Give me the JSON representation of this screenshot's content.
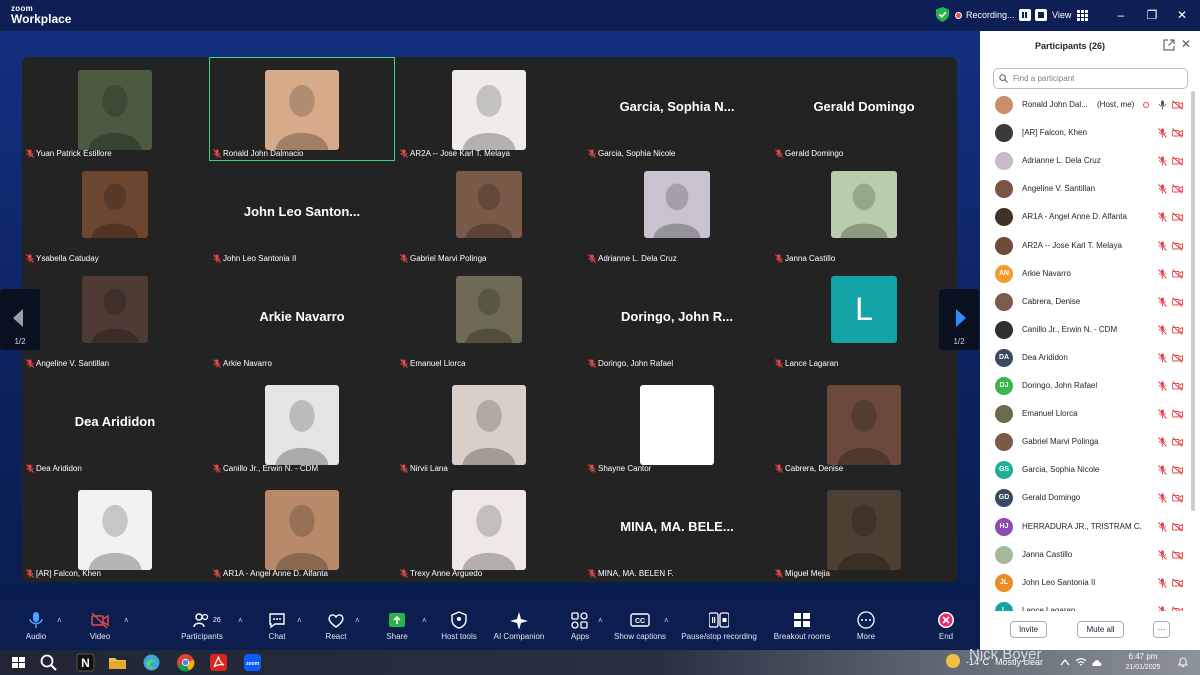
{
  "app": {
    "logo_small": "zoom",
    "logo_big": "Workplace",
    "recording_label": "Recording...",
    "view_label": "View"
  },
  "grid": {
    "tiles": [
      {
        "name": "Yuan Patrick Estillore",
        "display": "photo",
        "photo_color": "#4c5a42",
        "active": false
      },
      {
        "name": "Ronald John Dalmacio",
        "display": "photo",
        "photo_color": "#d7ab8a",
        "active": true
      },
      {
        "name": "AR2A -- Jose Karl T. Melaya",
        "display": "photo",
        "photo_color": "#f0ede8",
        "active": false
      },
      {
        "name": "Garcia, Sophia Nicole",
        "display": "name",
        "big_name": "Garcia, Sophia N...",
        "active": false
      },
      {
        "name": "Gerald Domingo",
        "display": "name",
        "big_name": "Gerald Domingo",
        "active": false
      },
      {
        "name": "Ysabella Catuday",
        "display": "photo",
        "photo_color": "#6d4630",
        "active": false
      },
      {
        "name": "John Leo Santonia II",
        "display": "name",
        "big_name": "John Leo Santon...",
        "active": false
      },
      {
        "name": "Gabriel Marvi Polinga",
        "display": "photo",
        "photo_color": "#7a5a48",
        "active": false
      },
      {
        "name": "Adrianne L. Dela Cruz",
        "display": "photo",
        "photo_color": "#c9c3cf",
        "active": false
      },
      {
        "name": "Janna Castillo",
        "display": "photo",
        "photo_color": "#b9ccab",
        "active": false
      },
      {
        "name": "Angeline V. Santillan",
        "display": "photo",
        "photo_color": "#4e3b34",
        "active": false
      },
      {
        "name": "Arkie Navarro",
        "display": "name",
        "big_name": "Arkie Navarro",
        "active": false
      },
      {
        "name": "Emanuel Llorca",
        "display": "photo",
        "photo_color": "#6e6a55",
        "active": false
      },
      {
        "name": "Doringo, John Rafael",
        "display": "name",
        "big_name": "Doringo, John R...",
        "active": false
      },
      {
        "name": "Lance Lagaran",
        "display": "letter",
        "letter": "L",
        "letter_color": "#14a3a6",
        "active": false
      },
      {
        "name": "Dea Arididon",
        "display": "name",
        "big_name": "Dea Arididon",
        "active": false
      },
      {
        "name": "Canillo Jr., Erwin N. - CDM",
        "display": "photo",
        "photo_color": "#e6e5e3",
        "active": false
      },
      {
        "name": "Nirvii Lana",
        "display": "photo",
        "photo_color": "#d9cfc8",
        "active": false
      },
      {
        "name": "Shayne Cantor",
        "display": "blank",
        "photo_color": "#ffffff",
        "active": false
      },
      {
        "name": "Cabrera, Denise",
        "display": "photo",
        "photo_color": "#6b4a3d",
        "active": false
      },
      {
        "name": "[AR] Falcon, Khen",
        "display": "photo",
        "photo_color": "#f2f2f2",
        "active": false
      },
      {
        "name": "AR1A - Angel Anne D. Alfanta",
        "display": "photo",
        "photo_color": "#b98a6a",
        "active": false
      },
      {
        "name": "Trexy Anne Arguedo",
        "display": "photo",
        "photo_color": "#f0e8e4",
        "active": false
      },
      {
        "name": "MINA, MA. BELEN F.",
        "display": "name",
        "big_name": "MINA, MA. BELE...",
        "active": false
      },
      {
        "name": "Miguel Mejia",
        "display": "photo",
        "photo_color": "#4d4032",
        "active": false
      }
    ],
    "page_left": "1/2",
    "page_right": "1/2"
  },
  "toolbar": {
    "items": [
      {
        "key": "audio",
        "label": "Audio",
        "icon": "microphone-icon",
        "caret": true
      },
      {
        "key": "video",
        "label": "Video",
        "icon": "video-off-icon",
        "caret": true
      },
      {
        "key": "participants",
        "label": "Participants",
        "icon": "participants-icon",
        "caret": true,
        "count": "26"
      },
      {
        "key": "chat",
        "label": "Chat",
        "icon": "chat-icon",
        "caret": true
      },
      {
        "key": "react",
        "label": "React",
        "icon": "heart-icon",
        "caret": true
      },
      {
        "key": "share",
        "label": "Share",
        "icon": "share-icon",
        "caret": true
      },
      {
        "key": "host_tools",
        "label": "Host tools",
        "icon": "shield-icon",
        "caret": false
      },
      {
        "key": "ai_companion",
        "label": "AI Companion",
        "icon": "sparkle-icon",
        "caret": false
      },
      {
        "key": "apps",
        "label": "Apps",
        "icon": "apps-icon",
        "caret": true
      },
      {
        "key": "captions",
        "label": "Show captions",
        "icon": "captions-icon",
        "caret": true
      },
      {
        "key": "recording",
        "label": "Pause/stop recording",
        "icon": "recording-controls-icon",
        "caret": false
      },
      {
        "key": "breakout",
        "label": "Breakout rooms",
        "icon": "breakout-icon",
        "caret": false
      },
      {
        "key": "more",
        "label": "More",
        "icon": "more-icon",
        "caret": false
      },
      {
        "key": "end",
        "label": "End",
        "icon": "end-icon",
        "caret": false
      }
    ]
  },
  "panel": {
    "title": "Participants (26)",
    "search_placeholder": "Find a participant",
    "participants": [
      {
        "name": "Ronald John Dal...",
        "role": "(Host, me)",
        "avatar": "photo",
        "color": "#c98f6a",
        "mic": "on"
      },
      {
        "name": "[AR] Falcon, Khen",
        "avatar": "photo",
        "color": "#3a3a3a",
        "mic": "off"
      },
      {
        "name": "Adrianne L. Dela Cruz",
        "avatar": "photo",
        "color": "#c9b8c8",
        "mic": "off"
      },
      {
        "name": "Angeline V. Santillan",
        "avatar": "photo",
        "color": "#7a5444",
        "mic": "off"
      },
      {
        "name": "AR1A - Angel Anne D. Alfanta",
        "avatar": "photo",
        "color": "#3d3327",
        "mic": "off"
      },
      {
        "name": "AR2A -- Jose Karl T. Melaya",
        "avatar": "photo",
        "color": "#6e4a3a",
        "mic": "off"
      },
      {
        "name": "Arkie Navarro",
        "avatar": "initials",
        "initials": "AN",
        "color": "#f39b2d",
        "mic": "off"
      },
      {
        "name": "Cabrera, Denise",
        "avatar": "photo",
        "color": "#7b5b4b",
        "mic": "off"
      },
      {
        "name": "Canillo Jr., Erwin N. - CDM",
        "avatar": "photo",
        "color": "#2f2f2f",
        "mic": "off"
      },
      {
        "name": "Dea Arididon",
        "avatar": "initials",
        "initials": "DA",
        "color": "#3a4a62",
        "mic": "off"
      },
      {
        "name": "Doringo, John Rafael",
        "avatar": "initials",
        "initials": "DJ",
        "color": "#3cb84a",
        "mic": "off"
      },
      {
        "name": "Emanuel Llorca",
        "avatar": "photo",
        "color": "#6c6b4f",
        "mic": "off"
      },
      {
        "name": "Gabriel Marvi Polinga",
        "avatar": "photo",
        "color": "#7a5a48",
        "mic": "off"
      },
      {
        "name": "Garcia, Sophia Nicole",
        "avatar": "initials",
        "initials": "GS",
        "color": "#1fae9a",
        "mic": "off"
      },
      {
        "name": "Gerald Domingo",
        "avatar": "initials",
        "initials": "GD",
        "color": "#3a4a62",
        "mic": "off"
      },
      {
        "name": "HERRADURA JR., TRISTRAM C.",
        "avatar": "initials",
        "initials": "HJ",
        "color": "#8d4bb3",
        "mic": "off"
      },
      {
        "name": "Janna Castillo",
        "avatar": "photo",
        "color": "#a7b998",
        "mic": "off"
      },
      {
        "name": "John Leo Santonia II",
        "avatar": "initials",
        "initials": "JL",
        "color": "#f08a24",
        "mic": "off"
      },
      {
        "name": "Lance Lagaran",
        "avatar": "initials",
        "initials": "L",
        "color": "#14a3a6",
        "mic": "off"
      }
    ],
    "invite_label": "Invite",
    "mute_all_label": "Mute all",
    "more_label": "···"
  },
  "taskbar": {
    "apps": [
      "windows-icon",
      "search-icon",
      "notion-icon",
      "file-explorer-icon",
      "edge-icon",
      "chrome-icon",
      "acrobat-icon",
      "zoom-icon"
    ],
    "weather_temp": "-14°C",
    "weather_text": "Mostly clear",
    "watermark": "Nick Boyer",
    "time": "6:47 pm",
    "date": "21/01/2025"
  }
}
